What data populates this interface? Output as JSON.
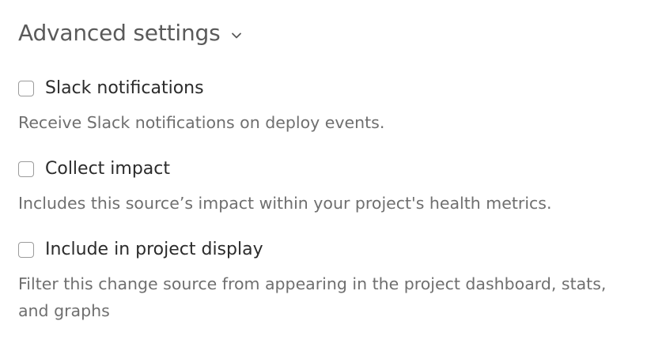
{
  "advanced_settings": {
    "title": "Advanced settings",
    "toggle_icon": "chevron-down-icon",
    "options": [
      {
        "label": "Slack notifications",
        "checked": false,
        "description": "Receive Slack notifications on deploy events."
      },
      {
        "label": "Collect impact",
        "checked": false,
        "description": "Includes this source’s impact within your project's health metrics."
      },
      {
        "label": "Include in project display",
        "checked": false,
        "description": "Filter this change source from appearing in the project dashboard, stats, and graphs"
      }
    ]
  },
  "colors": {
    "heading": "#5a5a5a",
    "label": "#2b2b2b",
    "description": "#6f6f6f",
    "checkbox_border": "#9b9b9b"
  }
}
